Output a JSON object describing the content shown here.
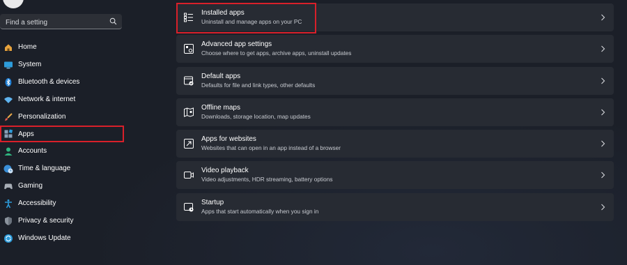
{
  "search": {
    "placeholder": "Find a setting"
  },
  "sidebar": {
    "items": [
      {
        "label": "Home",
        "icon": "home-icon"
      },
      {
        "label": "System",
        "icon": "monitor-icon"
      },
      {
        "label": "Bluetooth & devices",
        "icon": "bluetooth-icon"
      },
      {
        "label": "Network & internet",
        "icon": "wifi-icon"
      },
      {
        "label": "Personalization",
        "icon": "brush-icon"
      },
      {
        "label": "Apps",
        "icon": "apps-icon",
        "selected": true
      },
      {
        "label": "Accounts",
        "icon": "person-icon"
      },
      {
        "label": "Time & language",
        "icon": "globe-clock-icon"
      },
      {
        "label": "Gaming",
        "icon": "gamepad-icon"
      },
      {
        "label": "Accessibility",
        "icon": "accessibility-icon"
      },
      {
        "label": "Privacy & security",
        "icon": "shield-icon"
      },
      {
        "label": "Windows Update",
        "icon": "update-icon"
      }
    ]
  },
  "main": {
    "rows": [
      {
        "title": "Installed apps",
        "subtitle": "Uninstall and manage apps on your PC",
        "icon": "list-icon"
      },
      {
        "title": "Advanced app settings",
        "subtitle": "Choose where to get apps, archive apps, uninstall updates",
        "icon": "app-settings-icon"
      },
      {
        "title": "Default apps",
        "subtitle": "Defaults for file and link types, other defaults",
        "icon": "default-apps-icon"
      },
      {
        "title": "Offline maps",
        "subtitle": "Downloads, storage location, map updates",
        "icon": "map-icon"
      },
      {
        "title": "Apps for websites",
        "subtitle": "Websites that can open in an app instead of a browser",
        "icon": "open-in-app-icon"
      },
      {
        "title": "Video playback",
        "subtitle": "Video adjustments, HDR streaming, battery options",
        "icon": "video-icon"
      },
      {
        "title": "Startup",
        "subtitle": "Apps that start automatically when you sign in",
        "icon": "startup-icon"
      }
    ]
  },
  "colors": {
    "highlight": "#d9202a",
    "background": "#1b1f28",
    "card": "#272b33"
  }
}
